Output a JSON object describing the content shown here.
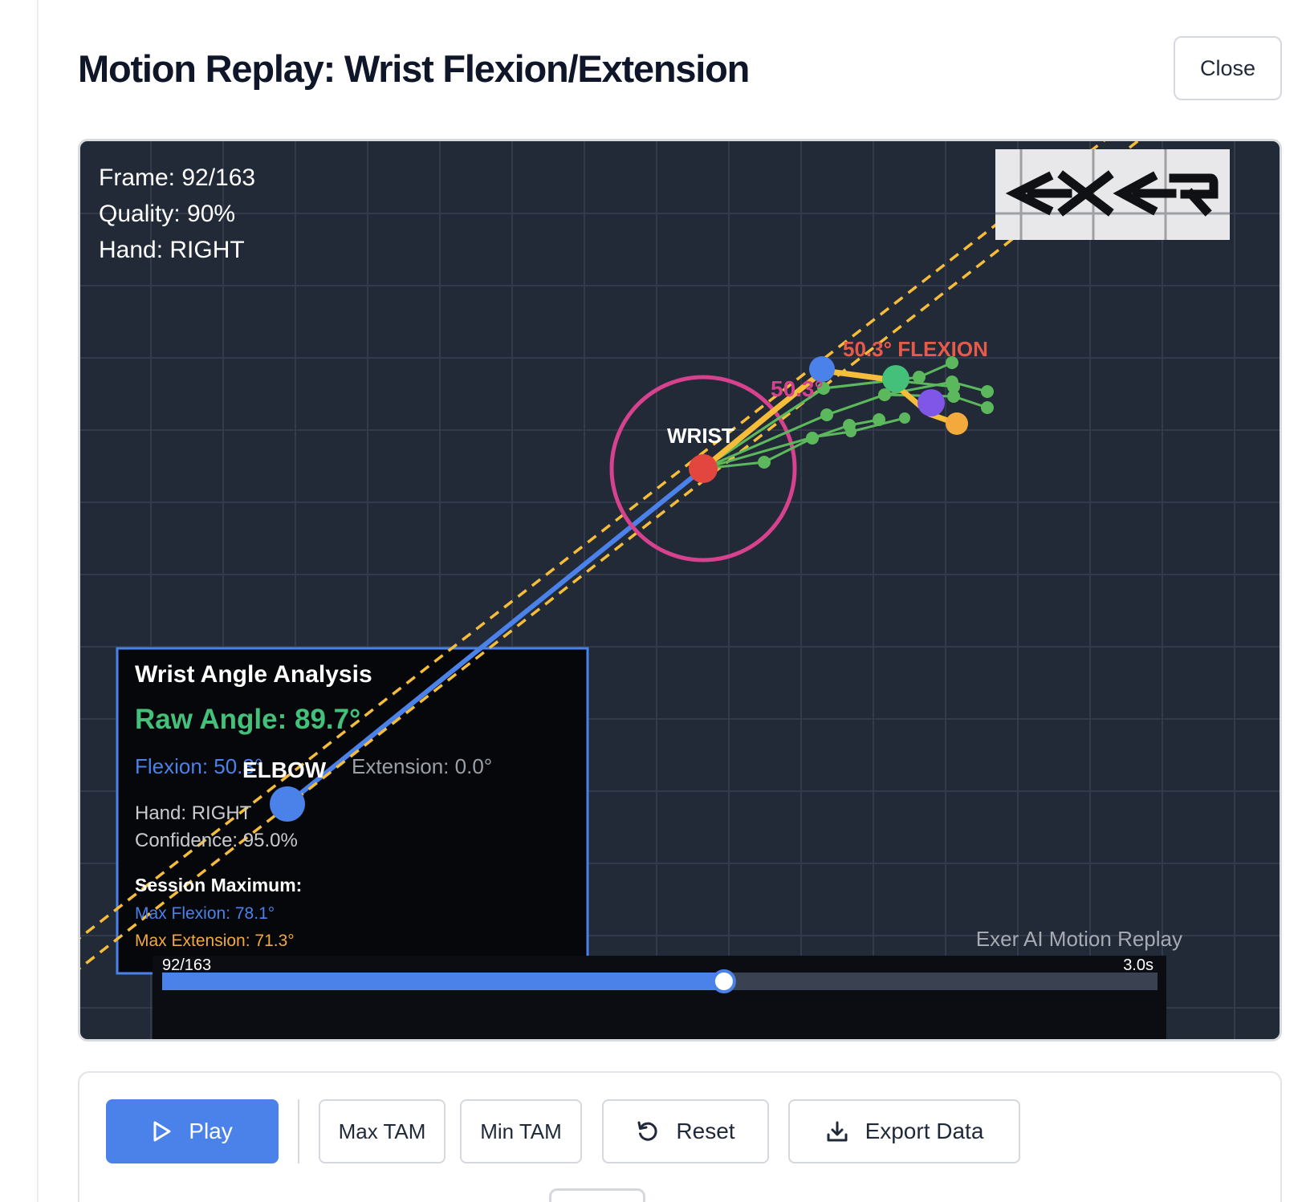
{
  "header": {
    "title": "Motion Replay: Wrist Flexion/Extension",
    "close_label": "Close"
  },
  "overlay": {
    "frame": "Frame: 92/163",
    "quality": "Quality: 90%",
    "hand": "Hand: RIGHT"
  },
  "logo": {
    "text": "EXER"
  },
  "joints": {
    "wrist_label": "WRIST",
    "elbow_label": "ELBOW"
  },
  "angle_labels": {
    "flexion_tag": "50.3° FLEXION",
    "arc_value": "50.3°"
  },
  "analysis": {
    "title": "Wrist Angle Analysis",
    "raw_angle": "Raw Angle: 89.7°",
    "flexion": "Flexion: 50.3°",
    "extension": "Extension: 0.0°",
    "hand": "Hand: RIGHT",
    "confidence": "Confidence: 95.0%",
    "session_title": "Session Maximum:",
    "max_flexion": "Max Flexion: 78.1°",
    "max_extension": "Max Extension: 71.3°"
  },
  "watermark": "Exer AI Motion Replay",
  "timeline": {
    "frame_label": "92/163",
    "time_label": "3.0s",
    "current_frame": 92,
    "total_frames": 163
  },
  "controls": {
    "play_label": "Play",
    "max_tam_label": "Max TAM",
    "min_tam_label": "Min TAM",
    "reset_label": "Reset",
    "export_label": "Export Data"
  },
  "colors": {
    "canvas_bg": "#222937",
    "accent_blue": "#4b82ea",
    "wrist_red": "#e2463f",
    "ring_pink": "#d6428e",
    "finger_green": "#5cb85c",
    "bone_yellow": "#f5bd3a",
    "flexion_red": "#e55a4a",
    "raw_green": "#44c07a",
    "ext_orange": "#f3a93b"
  },
  "icons": {
    "play": "play-icon",
    "reset": "reset-icon",
    "export": "download-icon"
  }
}
